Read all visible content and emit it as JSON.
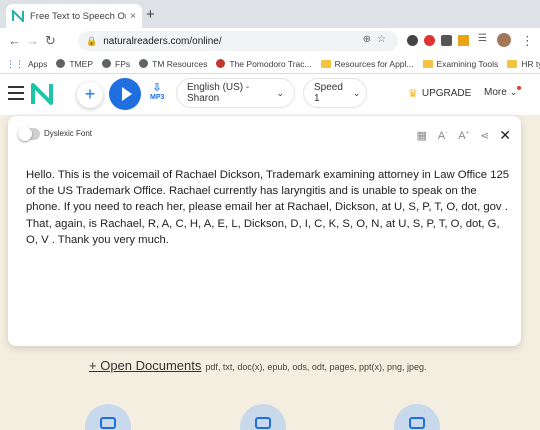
{
  "browser": {
    "tab_title": "Free Text to Speech Online with N",
    "tab_close": "×",
    "new_tab": "+",
    "url": "naturalreaders.com/online/",
    "window_controls": [
      "⌄",
      "—",
      "❐",
      "✕"
    ]
  },
  "bookmarks": [
    {
      "label": "Apps",
      "icon": "apps-grid-icon"
    },
    {
      "label": "TMEP",
      "icon": "globe-icon"
    },
    {
      "label": "FPs",
      "icon": "globe-icon"
    },
    {
      "label": "TM Resources",
      "icon": "globe-icon"
    },
    {
      "label": "The Pomodoro Trac...",
      "icon": "tomato-icon"
    },
    {
      "label": "Resources for Appl...",
      "icon": "folder-icon"
    },
    {
      "label": "Examining Tools",
      "icon": "folder-icon"
    },
    {
      "label": "HR type and person...",
      "icon": "folder-icon"
    }
  ],
  "app": {
    "voice": "English (US) - Sharon",
    "speed": "Speed 1",
    "upgrade": "UPGRADE",
    "more": "More",
    "mp3": "MP3"
  },
  "editor": {
    "dyslexic_label": "Dyslexic Font",
    "text": "Hello. This is the voicemail of Rachael Dickson, Trademark examining attorney in Law Office 125 of the US Trademark Office. Rachael currently has laryngitis and is unable to speak on the phone. If you need to reach her, please email her at Rachael, Dickson, at U, S, P, T, O, dot, gov . That, again, is Rachael, R, A, C, H, A, E, L, Dickson, D, I, C, K, S, O, N, at U, S, P, T, O, dot, G, O, V . Thank you very much."
  },
  "open_docs": {
    "link": "+ Open Documents",
    "formats": "pdf, txt, doc(x), epub, ods, odt, pages, ppt(x), png, jpeg."
  },
  "colors": {
    "accent": "#1f6fe0",
    "page_bg": "#f3eedf"
  }
}
